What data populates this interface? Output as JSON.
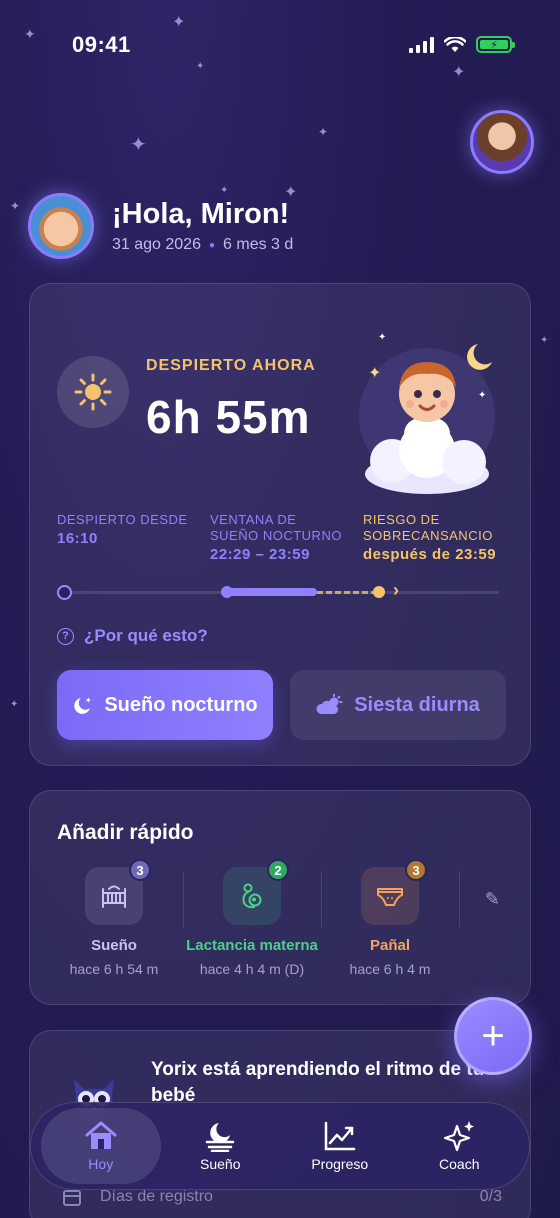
{
  "status_bar": {
    "time": "09:41"
  },
  "header": {
    "greeting": "¡Hola, Miron!",
    "date": "31 ago 2026",
    "age": "6 mes 3 d"
  },
  "main_card": {
    "state_label": "DESPIERTO AHORA",
    "duration": "6h 55m",
    "metrics": [
      {
        "label_line1": "DESPIERTO DESDE",
        "label_line2": "",
        "value": "16:10"
      },
      {
        "label_line1": "VENTANA DE",
        "label_line2": "SUEÑO NOCTURNO",
        "value": "22:29 – 23:59"
      },
      {
        "label_line1": "RIESGO DE",
        "label_line2": "SOBRECANSANCIO",
        "value": "después de 23:59"
      }
    ],
    "why_link": "¿Por qué esto?",
    "btn_night": "Sueño nocturno",
    "btn_nap": "Siesta diurna"
  },
  "quick_add": {
    "title": "Añadir rápido",
    "items": [
      {
        "label": "Sueño",
        "time": "hace 6 h 54 m",
        "badge": "3",
        "color": "#c9c4f0",
        "badge_color": "#6f6ab8"
      },
      {
        "label": "Lactancia materna",
        "time": "hace 4 h 4 m (D)",
        "badge": "2",
        "color": "#4cd08a",
        "badge_color": "#2fa862"
      },
      {
        "label": "Pañal",
        "time": "hace 6 h 4 m",
        "badge": "3",
        "color": "#f5a45a",
        "badge_color": "#b27a2e"
      }
    ]
  },
  "ai_card": {
    "title": "Yorix está aprendiendo el ritmo de tu bebé",
    "records_label": "Días de registro",
    "records_count": "0/3"
  },
  "tabs": [
    {
      "label": "Hoy",
      "icon": "home-icon"
    },
    {
      "label": "Sueño",
      "icon": "moon-icon"
    },
    {
      "label": "Progreso",
      "icon": "chart-icon"
    },
    {
      "label": "Coach",
      "icon": "sparkle-icon"
    }
  ],
  "colors": {
    "accent": "#8f80ff",
    "warning": "#f5c46a",
    "background": "#241d55"
  }
}
